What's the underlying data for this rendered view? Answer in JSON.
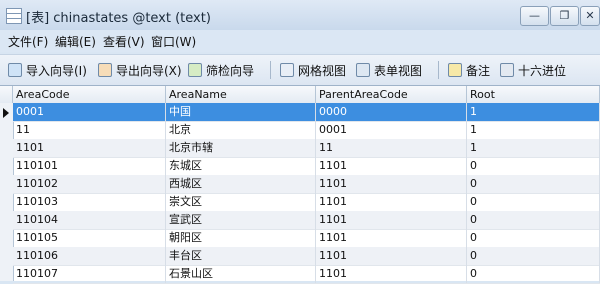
{
  "window": {
    "title": "[表] chinastates @text (text)",
    "minimize_glyph": "—",
    "restore_glyph": "❐",
    "close_glyph": "✕"
  },
  "menu": [
    {
      "label": "文件(F)"
    },
    {
      "label": "编辑(E)"
    },
    {
      "label": "查看(V)"
    },
    {
      "label": "窗口(W)"
    }
  ],
  "toolbar": [
    {
      "label": "导入向导(I)",
      "icon": "import-icon"
    },
    {
      "label": "导出向导(X)",
      "icon": "export-icon"
    },
    {
      "label": "筛检向导",
      "icon": "filter-icon"
    },
    {
      "label": "网格视图",
      "icon": "grid-view-icon"
    },
    {
      "label": "表单视图",
      "icon": "form-view-icon"
    },
    {
      "label": "备注",
      "icon": "memo-icon"
    },
    {
      "label": "十六进位",
      "icon": "hex-icon"
    }
  ],
  "table": {
    "columns": [
      "AreaCode",
      "AreaName",
      "ParentAreaCode",
      "Root"
    ],
    "rows": [
      [
        "0001",
        "中国",
        "0000",
        "1"
      ],
      [
        "11",
        "北京",
        "0001",
        "1"
      ],
      [
        "1101",
        "北京市辖",
        "11",
        "1"
      ],
      [
        "110101",
        "东城区",
        "1101",
        "0"
      ],
      [
        "110102",
        "西城区",
        "1101",
        "0"
      ],
      [
        "110103",
        "崇文区",
        "1101",
        "0"
      ],
      [
        "110104",
        "宣武区",
        "1101",
        "0"
      ],
      [
        "110105",
        "朝阳区",
        "1101",
        "0"
      ],
      [
        "110106",
        "丰台区",
        "1101",
        "0"
      ],
      [
        "110107",
        "石景山区",
        "1101",
        "0"
      ]
    ],
    "selected_row": 0
  },
  "colors": {
    "selection": "#3d8ee0",
    "alt_row": "#eef1f6",
    "frame": "#d9e6f3"
  }
}
